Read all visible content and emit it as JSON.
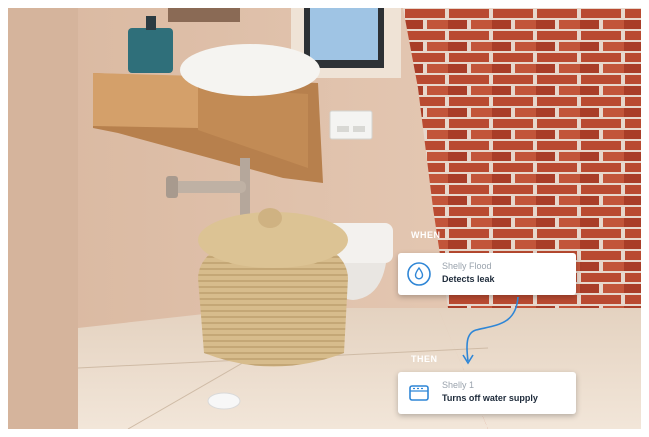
{
  "automation": {
    "when_label": "WHEN",
    "then_label": "THEN",
    "trigger": {
      "device": "Shelly Flood",
      "action": "Detects leak",
      "icon": "water-drop-icon"
    },
    "result": {
      "device": "Shelly 1",
      "action": "Turns off water supply",
      "icon": "relay-device-icon"
    }
  },
  "colors": {
    "accent": "#2f86d6",
    "card": "#ffffff",
    "brick": "#b5432c"
  }
}
